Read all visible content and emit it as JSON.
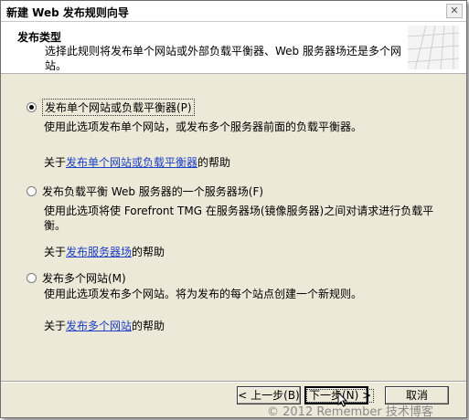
{
  "window": {
    "title": "新建 Web 发布规则向导",
    "close_symbol": "✕"
  },
  "header": {
    "title": "发布类型",
    "description": "选择此规则将发布单个网站或外部负载平衡器、Web 服务器场还是多个网站。"
  },
  "options": [
    {
      "label": "发布单个网站或负载平衡器(P)",
      "selected": true,
      "description": "使用此选项发布单个网站，或发布多个服务器前面的负载平衡器。",
      "help_prefix": "关于",
      "help_link": "发布单个网站或负载平衡器",
      "help_suffix": "的帮助"
    },
    {
      "label": "发布负载平衡 Web 服务器的一个服务器场(F)",
      "selected": false,
      "description": "使用此选项将使 Forefront TMG 在服务器场(镜像服务器)之间对请求进行负载平衡。",
      "help_prefix": "关于",
      "help_link": "发布服务器场",
      "help_suffix": "的帮助"
    },
    {
      "label": "发布多个网站(M)",
      "selected": false,
      "description": "使用此选项发布多个网站。将为发布的每个站点创建一个新规则。",
      "help_prefix": "关于",
      "help_link": "发布多个网站",
      "help_suffix": "的帮助"
    }
  ],
  "buttons": {
    "back": "< 上一步(B)",
    "next": "下一步(N) >",
    "cancel": "取消"
  },
  "watermark": "© 2012 Remember 技术博客",
  "icons": {
    "header_graphic": "wizard-banner-icon",
    "cursor": "mouse-pointer-icon"
  }
}
